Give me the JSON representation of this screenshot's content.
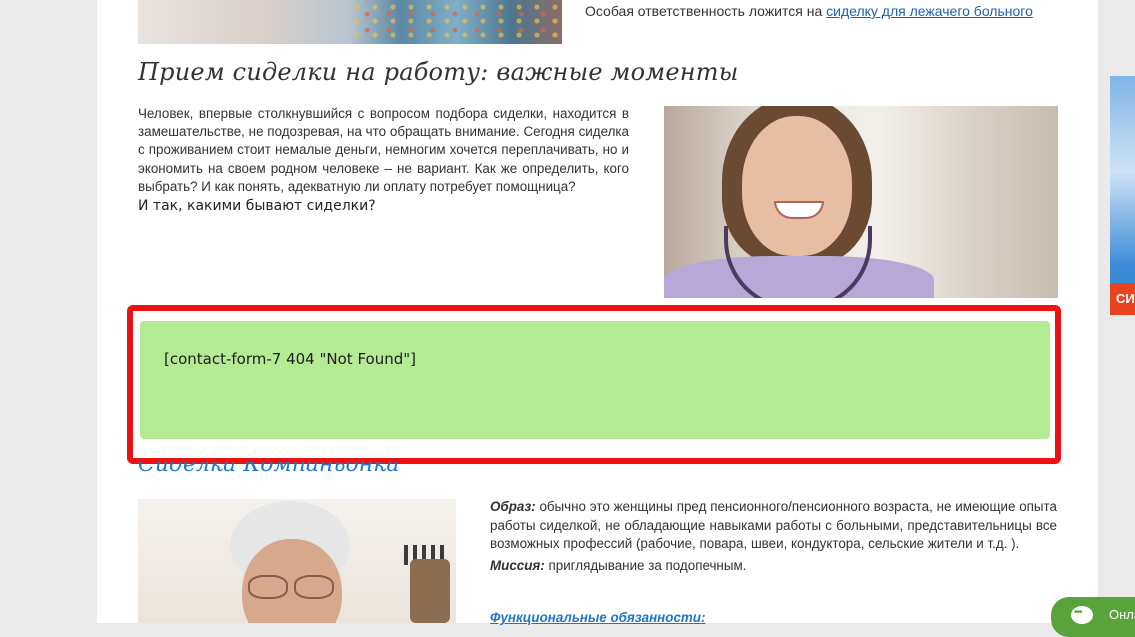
{
  "top": {
    "text": "Особая ответственность ложится на",
    "link": "сиделку для лежачего больного"
  },
  "section": {
    "title": "Прием сиделки на работу: важные моменты",
    "intro": "Человек, впервые столкнувшийся с вопросом подбора сиделки, находится в замешательстве, не подозревая, на что обращать внимание. Сегодня сиделка с проживанием стоит немалые деньги, немногим хочется переплачивать, но и экономить на своем родном человеке – не вариант. Как же определить, кого выбрать? И как понять, адекватную ли оплату потребует помощница?",
    "question": "И так, какими бывают сиделки?"
  },
  "form": {
    "text": "[contact-form-7 404 \"Not Found\"]"
  },
  "companion": {
    "title": "Сиделка Компаньонка",
    "image_label": "Образ:",
    "image_text": "обычно это женщины пред пенсионного/пенсионного возраста, не имеющие опыта работы сиделкой, не обладающие навыками работы с больными, представительницы все возможных профессий (рабочие, повара, швеи, кондуктора, сельские жители и т.д. ).",
    "mission_label": "Миссия:",
    "mission_text": "приглядывание за подопечным.",
    "duties": "Функциональные обязанности:"
  },
  "side_banner": {
    "text": "СИ"
  },
  "chat": {
    "label": "Онлайн"
  },
  "colors": {
    "highlight": "#ee1111",
    "form_bg": "#b4eb95",
    "link": "#1e5fae",
    "heading_blue": "#1f77c9",
    "chat_green": "#5aa33a"
  }
}
